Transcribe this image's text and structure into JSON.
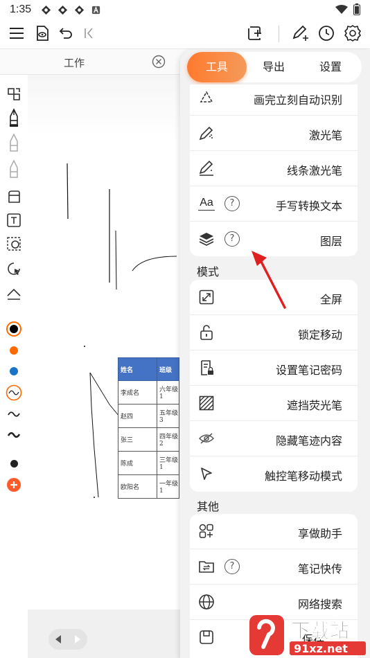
{
  "status_bar": {
    "time": "1:35"
  },
  "tab": {
    "title": "工作"
  },
  "panel": {
    "tabs": [
      {
        "label": "工具",
        "active": true
      },
      {
        "label": "导出",
        "active": false
      },
      {
        "label": "设置",
        "active": false
      }
    ],
    "tools": [
      {
        "label": "画完立刻自动识别",
        "icon": "shape-recognize-icon",
        "help": false
      },
      {
        "label": "激光笔",
        "icon": "laser-pen-icon",
        "help": false
      },
      {
        "label": "线条激光笔",
        "icon": "line-laser-pen-icon",
        "help": false
      },
      {
        "label": "手写转换文本",
        "icon": "handwriting-text-icon",
        "icon_text": "Aa",
        "help": true
      },
      {
        "label": "图层",
        "icon": "layers-icon",
        "help": true
      }
    ],
    "mode_title": "模式",
    "modes": [
      {
        "label": "全屏",
        "icon": "fullscreen-icon"
      },
      {
        "label": "锁定移动",
        "icon": "lock-icon"
      },
      {
        "label": "设置笔记密码",
        "icon": "note-password-icon"
      },
      {
        "label": "遮挡荧光笔",
        "icon": "highlighter-mask-icon"
      },
      {
        "label": "隐藏笔迹内容",
        "icon": "eye-hidden-icon"
      },
      {
        "label": "触控笔移动模式",
        "icon": "stylus-cursor-icon"
      }
    ],
    "other_title": "其他",
    "others": [
      {
        "label": "享做助手",
        "icon": "assistant-icon",
        "help": false
      },
      {
        "label": "笔记快传",
        "icon": "folder-transfer-icon",
        "help": true
      },
      {
        "label": "网络搜索",
        "icon": "globe-icon",
        "help": false
      },
      {
        "label": "保存",
        "icon": "save-icon",
        "help": false
      }
    ],
    "help_symbol": "?"
  },
  "canvas_table": {
    "headers": [
      "姓名",
      "班级"
    ],
    "rows": [
      [
        "李成名",
        "六年级1"
      ],
      [
        "赵四",
        "五年级3"
      ],
      [
        "张三",
        "四年级2"
      ],
      [
        "陈成",
        "三年级1"
      ],
      [
        "欧阳名",
        "一年级1"
      ]
    ]
  },
  "watermark": {
    "line1": "下载站",
    "line2": "91xz.net"
  },
  "colors": {
    "accent": "#ff7a2e",
    "arrow": "#e02020",
    "blue_pen": "#1a73c8",
    "orange_pen": "#ff6a00",
    "add_button": "#ff5a2a"
  }
}
